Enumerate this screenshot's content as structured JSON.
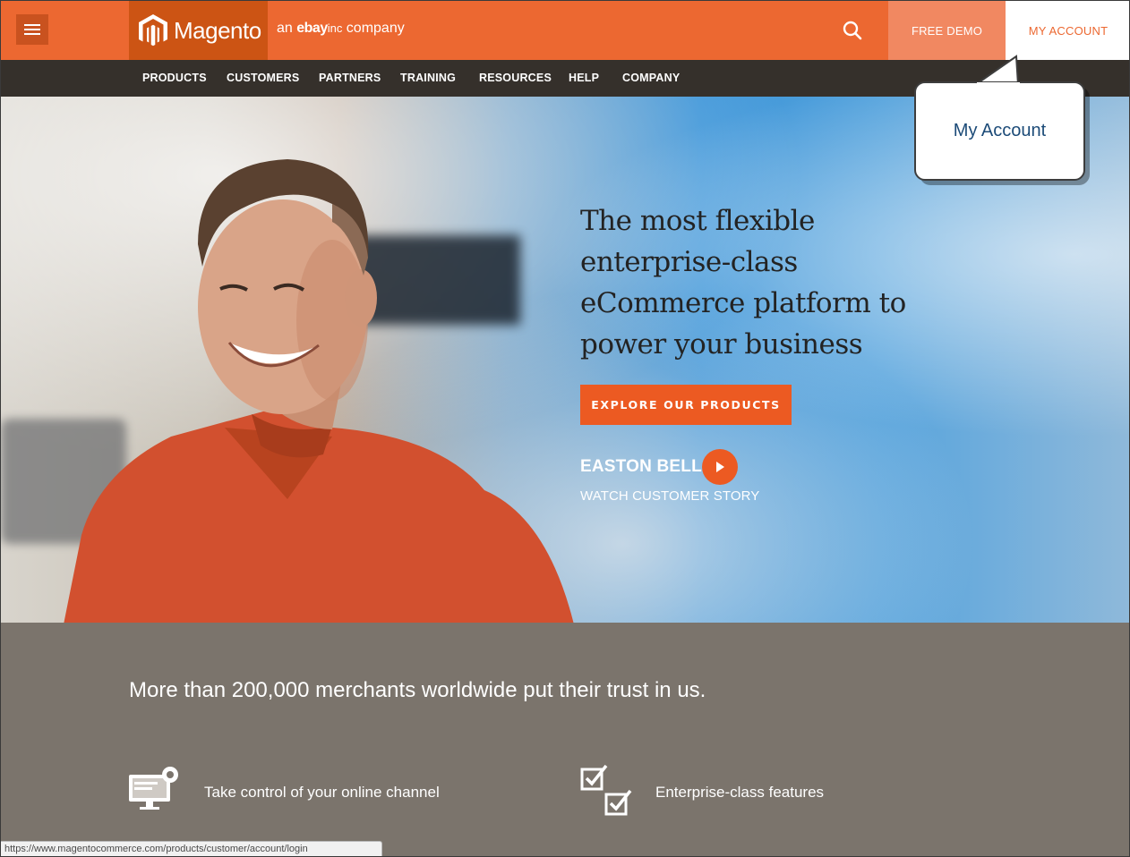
{
  "header": {
    "logo_text": "Magento",
    "tagline_prefix": "an",
    "tagline_brand": "ebay",
    "tagline_inc": "inc",
    "tagline_suffix": "company",
    "free_demo_label": "FREE DEMO",
    "my_account_label": "MY ACCOUNT",
    "accent_color": "#ec6831"
  },
  "nav": {
    "items": [
      "PRODUCTS",
      "CUSTOMERS",
      "PARTNERS",
      "TRAINING",
      "RESOURCES",
      "HELP",
      "COMPANY"
    ]
  },
  "hero": {
    "headline_lines": [
      "The most flexible",
      "enterprise-class",
      "eCommerce platform to",
      "power your business"
    ],
    "cta_label": "EXPLORE OUR PRODUCTS",
    "customer_name": "EASTON BELL",
    "customer_link": "WATCH CUSTOMER STORY"
  },
  "trust": {
    "heading": "More than 200,000 merchants worldwide put their trust in us.",
    "features": [
      {
        "icon": "monitor-gear-icon",
        "text": "Take control of your online channel"
      },
      {
        "icon": "checklist-icon",
        "text": "Enterprise-class features"
      }
    ]
  },
  "callout": {
    "text": "My Account"
  },
  "status_bar": {
    "url": "https://www.magentocommerce.com/products/customer/account/login"
  }
}
